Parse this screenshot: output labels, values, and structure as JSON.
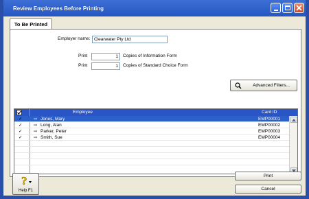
{
  "window": {
    "title": "Review Employees Before Printing"
  },
  "tabs": [
    {
      "label": "To Be Printed",
      "active": true
    }
  ],
  "form": {
    "employer_label": "Employer name:",
    "employer_value": "Clearwater Pty Ltd",
    "print_label_1": "Print",
    "info_copies": "1",
    "info_suffix": "Copies of Information Form",
    "print_label_2": "Print",
    "choice_copies": "1",
    "choice_suffix": "Copies of Standard Choice Form"
  },
  "filters": {
    "label": "Advanced Filters..."
  },
  "table": {
    "columns": [
      "Employee",
      "Card ID"
    ],
    "rows": [
      {
        "name": "Jones, Mary",
        "card_id": "EMP00001",
        "checked": true,
        "selected": true
      },
      {
        "name": "Long, Alan",
        "card_id": "EMP00002",
        "checked": true,
        "selected": false
      },
      {
        "name": "Parker, Peter",
        "card_id": "EMP00003",
        "checked": true,
        "selected": false
      },
      {
        "name": "Smith, Sue",
        "card_id": "EMP00004",
        "checked": true,
        "selected": false
      }
    ]
  },
  "buttons": {
    "print": "Print",
    "cancel": "Cancel",
    "help": "Help F1"
  },
  "colors": {
    "title_bar": "#2457c3",
    "header": "#2a55c7",
    "selection": "#2b5fc9",
    "face": "#ece9d8"
  }
}
